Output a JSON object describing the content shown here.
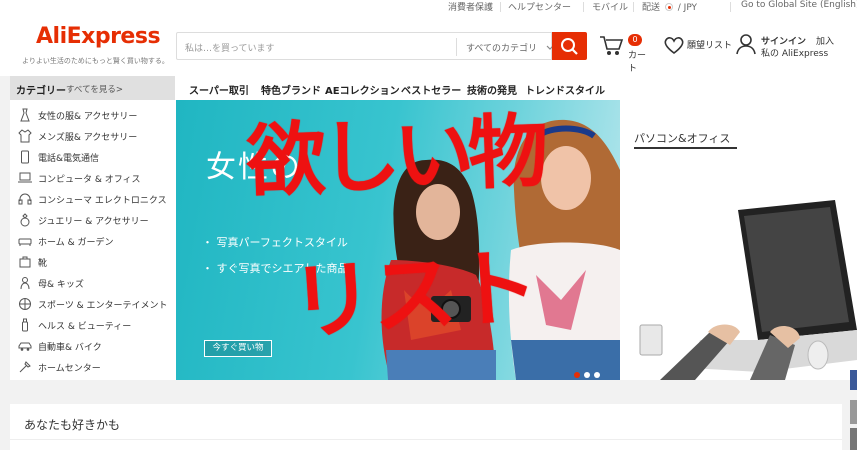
{
  "topbar": {
    "buyer_protection": "消費者保護",
    "help_center": "ヘルプセンター",
    "mobile": "モバイル",
    "ship_to": "配送",
    "currency": "/ JPY",
    "global_site": "Go to Global Site (English)"
  },
  "header": {
    "logo": "AliExpress",
    "tagline": "よりよい生活のためにもっと賢く買い物する。",
    "search_placeholder": "私は…を買っています",
    "search_category": "すべてのカテゴリ",
    "cart_count": "0",
    "cart_label": "カート",
    "wishlist_label": "願望リスト",
    "signin_label": "サインイン",
    "join_label": "加入",
    "my_aliexpress_label": "私の AliExpress"
  },
  "categories": {
    "title": "カテゴリー",
    "see_all": "すべてを見る>",
    "items": [
      {
        "label": "女性の服& アクセサリー",
        "icon": "dress-icon"
      },
      {
        "label": "メンズ服& アクセサリー",
        "icon": "shirt-icon"
      },
      {
        "label": "電話&電気通信",
        "icon": "phone-icon"
      },
      {
        "label": "コンピュータ & オフィス",
        "icon": "laptop-icon"
      },
      {
        "label": "コンシューマ エレクトロニクス",
        "icon": "headphones-icon"
      },
      {
        "label": "ジュエリー & アクセサリー",
        "icon": "ring-icon"
      },
      {
        "label": "ホーム & ガーデン",
        "icon": "sofa-icon"
      },
      {
        "label": "靴",
        "icon": "bag-icon"
      },
      {
        "label": "母& キッズ",
        "icon": "baby-icon"
      },
      {
        "label": "スポーツ & エンターテイメント",
        "icon": "ball-icon"
      },
      {
        "label": "ヘルス & ビューティー",
        "icon": "bottle-icon"
      },
      {
        "label": "自動車& バイク",
        "icon": "car-icon"
      },
      {
        "label": "ホームセンター",
        "icon": "tools-icon"
      }
    ]
  },
  "nav": {
    "items": [
      "スーパー取引",
      "特色ブランド",
      "AEコレクション",
      "ベストセラー",
      "技術の発見",
      "トレンドスタイル"
    ]
  },
  "banner": {
    "title": "女性の",
    "line1": "写真パーフェクトスタイル",
    "line2": "すぐ写真でシエアした商品",
    "cta": "今すぐ買い物"
  },
  "right_panel": {
    "title": "パソコン&オフィス"
  },
  "bottom": {
    "title": "あなたも好きかも"
  },
  "overlay": {
    "line1": "欲しい物",
    "line2": "リスト",
    "color": "#ee1111"
  },
  "colors": {
    "brand": "#e62e04",
    "banner_teal": "#20b6c2"
  }
}
